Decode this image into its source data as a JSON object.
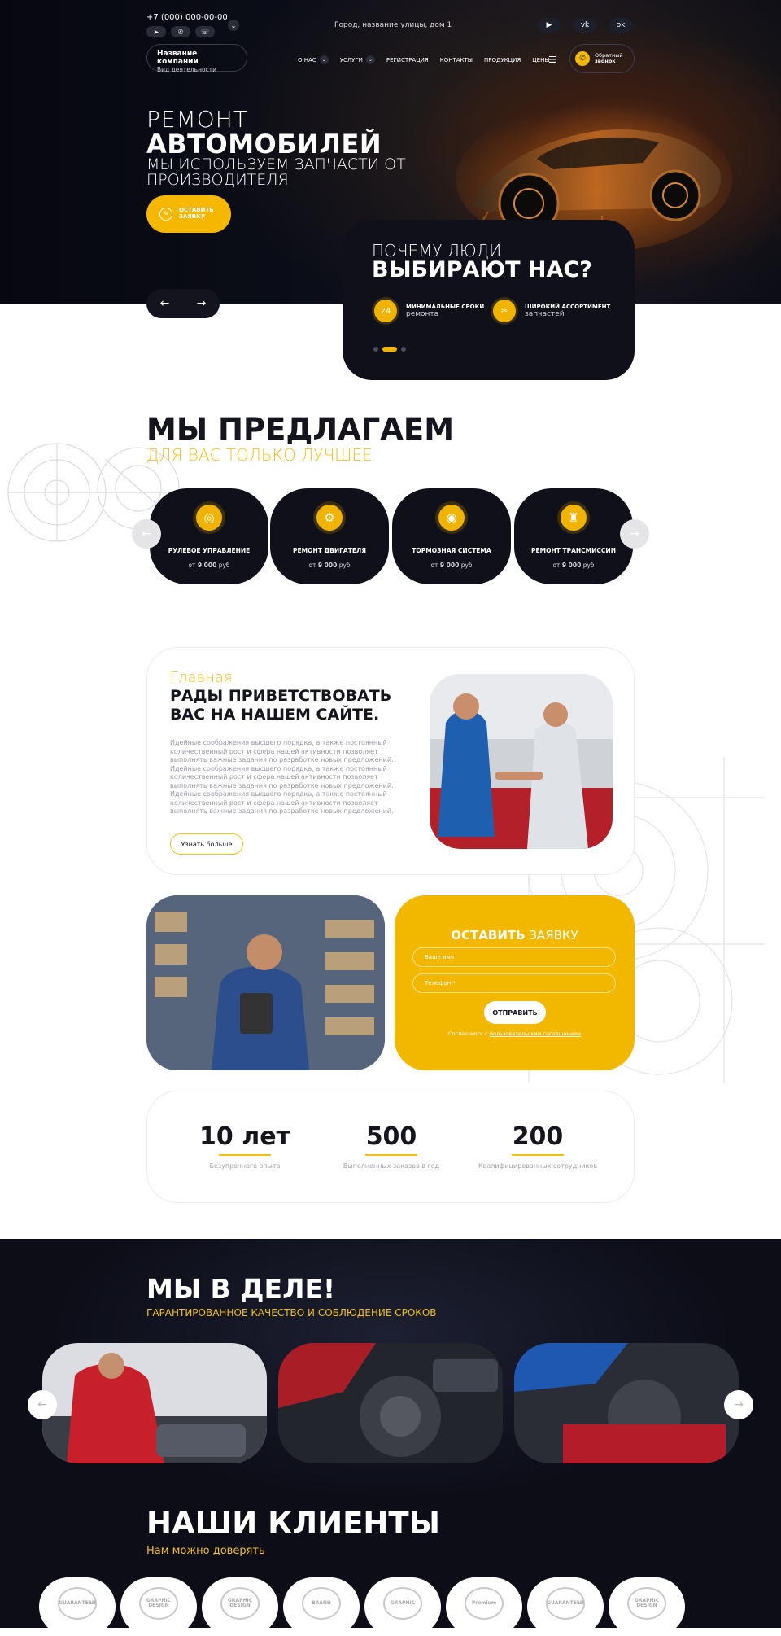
{
  "header": {
    "phone": "+7 (000) 000-00-00",
    "messengers": [
      "telegram-icon",
      "whatsapp-icon",
      "viber-icon"
    ],
    "address": "Город, название улицы, дом 1",
    "socials": [
      "youtube-icon",
      "vk-icon",
      "ok-icon"
    ],
    "company_name": "Название компании",
    "company_activity": "Вид деятельности",
    "nav": [
      {
        "label": "О НАС",
        "dropdown": true
      },
      {
        "label": "УСЛУГИ",
        "dropdown": true
      },
      {
        "label": "РЕГИСТРАЦИЯ",
        "dropdown": false
      },
      {
        "label": "КОНТАКТЫ",
        "dropdown": false
      },
      {
        "label": "ПРОДУКЦИЯ",
        "dropdown": false
      },
      {
        "label": "ЦЕНЫ",
        "dropdown": false
      }
    ],
    "callback_l1": "Обратный",
    "callback_l2": "звонок"
  },
  "hero": {
    "line1": "РЕМОНТ",
    "line2": "АВТОМОБИЛЕЙ",
    "line3": "МЫ ИСПОЛЬЗУЕМ ЗАПЧАСТИ ОТ ПРОИЗВОДИТЕЛЯ",
    "cta_l1": "ОСТАВИТЬ",
    "cta_l2": "ЗАЯВКУ",
    "prev": "←",
    "next": "→"
  },
  "why": {
    "title_light": "ПОЧЕМУ ЛЮДИ",
    "title_bold": "ВЫБИРАЮТ НАС?",
    "features": [
      {
        "bold": "МИНИМАЛЬНЫЕ СРОКИ",
        "text": "ремонта",
        "icon": "clock-24-icon"
      },
      {
        "bold": "ШИРОКИЙ АССОРТИМЕНТ",
        "text": "запчастей",
        "icon": "tools-icon"
      }
    ],
    "active_dot": 2,
    "dots_total": 3
  },
  "offer": {
    "title": "МЫ ПРЕДЛАГАЕМ",
    "subtitle": "ДЛЯ ВАС ТОЛЬКО ЛУЧШЕЕ",
    "services": [
      {
        "name": "РУЛЕВОЕ УПРАВЛЕНИЕ",
        "price_prefix": "от",
        "price": "9 000",
        "currency": "руб",
        "icon": "steering-wheel-icon"
      },
      {
        "name": "РЕМОНТ ДВИГАТЕЛЯ",
        "price_prefix": "от",
        "price": "9 000",
        "currency": "руб",
        "icon": "engine-icon"
      },
      {
        "name": "ТОРМОЗНАЯ СИСТЕМА",
        "price_prefix": "от",
        "price": "9 000",
        "currency": "руб",
        "icon": "brake-disc-icon"
      },
      {
        "name": "РЕМОНТ ТРАНСМИССИИ",
        "price_prefix": "от",
        "price": "9 000",
        "currency": "руб",
        "icon": "gear-shift-icon"
      }
    ],
    "prev": "←",
    "next": "→"
  },
  "welcome": {
    "subtitle": "Главная",
    "title": "РАДЫ ПРИВЕТСТВОВАТЬ ВАС НА НАШЕМ САЙТЕ.",
    "text": "Идейные соображения высшего порядка, а также постоянный количественный рост и сфера нашей активности позволяет выполнять важные задания по разработке новых предложений. Идейные соображения высшего порядка, а также постоянный количественный рост и сфера нашей активности позволяет выполнять важные задания по разработке новых предложений. Идейные соображения высшего порядка, а также постоянный количественный рост и сфера нашей активности позволяет выполнять важные задания по разработке новых предложений.",
    "button": "Узнать больше"
  },
  "form": {
    "title_bold": "ОСТАВИТЬ",
    "title_light": " ЗАЯВКУ",
    "name_placeholder": "Ваше имя",
    "phone_placeholder": "Телефон *",
    "submit": "ОТПРАВИТЬ",
    "agree_text": "Соглашаюсь с ",
    "agree_link": "пользовательским соглашением"
  },
  "stats": [
    {
      "value": "10 лет",
      "label": "Безупречного опыта"
    },
    {
      "value": "500",
      "label": "Выполненных заказов в год"
    },
    {
      "value": "200",
      "label": "Квалифицированных сотрудников"
    }
  ],
  "work": {
    "title": "МЫ В ДЕЛЕ!",
    "subtitle": "ГАРАНТИРОВАННОЕ КАЧЕСТВО И СОБЛЮДЕНИЕ СРОКОВ",
    "prev": "←",
    "next": "→"
  },
  "clients": {
    "title": "НАШИ КЛИЕНТЫ",
    "subtitle": "Нам можно доверять",
    "logos": [
      "GUARANTEED",
      "GRAPHIC DESIGN",
      "GRAPHIC DESIGN",
      "BRAND",
      "GRAPHIC",
      "Premium",
      "GUARANTEED",
      "GRAPHIC DESIGN"
    ]
  },
  "colors": {
    "accent": "#f2b800",
    "dark": "#0f1019",
    "text": "#15151e"
  }
}
